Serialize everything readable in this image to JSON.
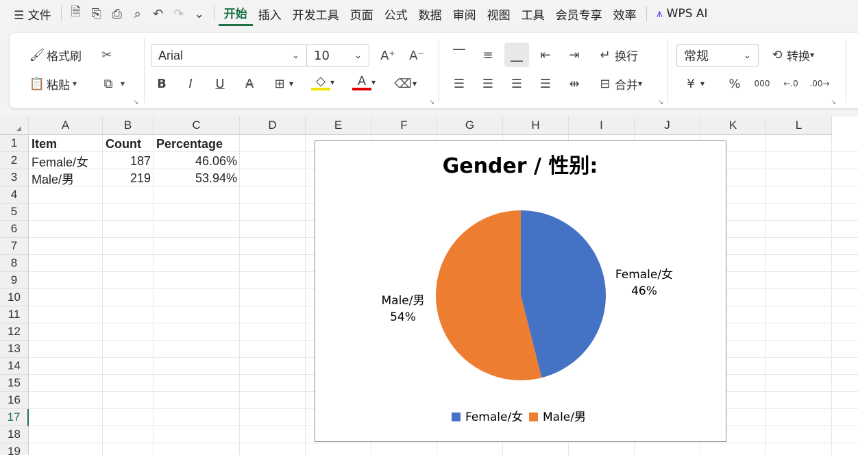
{
  "menu": {
    "file": "文件",
    "tabs": [
      "开始",
      "插入",
      "开发工具",
      "页面",
      "公式",
      "数据",
      "审阅",
      "视图",
      "工具",
      "会员专享",
      "效率"
    ],
    "ai": "WPS AI"
  },
  "ribbon": {
    "format_painter": "格式刷",
    "paste": "粘贴",
    "font_name": "Arial",
    "font_size": "10",
    "wrap": "换行",
    "merge": "合并",
    "number_format": "常规",
    "convert": "转换"
  },
  "sheet": {
    "columns": [
      "A",
      "B",
      "C",
      "D",
      "E",
      "F",
      "G",
      "H",
      "I",
      "J",
      "K",
      "L"
    ],
    "rows": [
      "1",
      "2",
      "3",
      "4",
      "5",
      "6",
      "7",
      "8",
      "9",
      "10",
      "11",
      "12",
      "13",
      "14",
      "15",
      "16",
      "17",
      "18",
      "19"
    ],
    "selected_row": "17",
    "headers": {
      "item": "Item",
      "count": "Count",
      "percentage": "Percentage"
    },
    "data": [
      {
        "item": "Female/女",
        "count": "187",
        "percentage": "46.06%"
      },
      {
        "item": "Male/男",
        "count": "219",
        "percentage": "53.94%"
      }
    ]
  },
  "chart_data": {
    "type": "pie",
    "title": "Gender / 性别:",
    "categories": [
      "Female/女",
      "Male/男"
    ],
    "values": [
      187,
      219
    ],
    "labels": [
      "46%",
      "54%"
    ],
    "colors": [
      "#4472c4",
      "#ed7d31"
    ],
    "legend": "bottom"
  }
}
